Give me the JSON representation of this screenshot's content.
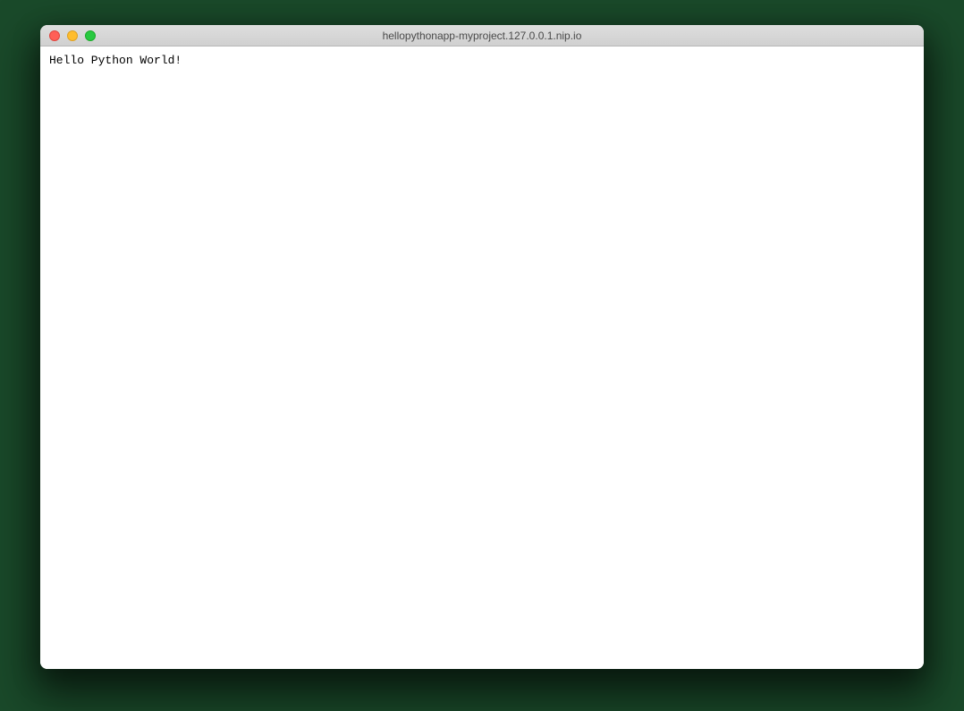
{
  "window": {
    "title": "hellopythonapp-myproject.127.0.0.1.nip.io",
    "traffic_lights": {
      "close_color": "#ff5f57",
      "minimize_color": "#ffbd2e",
      "maximize_color": "#28c940"
    }
  },
  "content": {
    "body_text": "Hello Python World!"
  }
}
